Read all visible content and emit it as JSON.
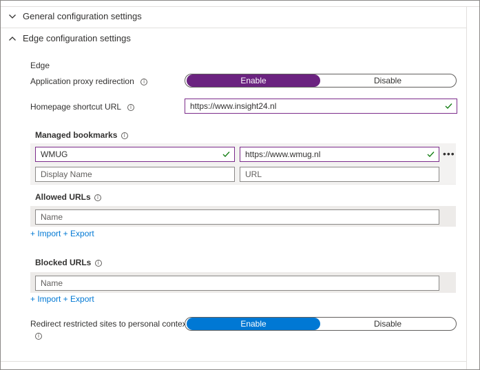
{
  "sections": {
    "general": {
      "title": "General configuration settings"
    },
    "edge": {
      "title": "Edge configuration settings"
    }
  },
  "edge": {
    "heading": "Edge",
    "proxy": {
      "label": "Application proxy redirection",
      "enable": "Enable",
      "disable": "Disable",
      "selected": "Enable",
      "accent": "#6b2380"
    },
    "homepage": {
      "label": "Homepage shortcut URL",
      "value": "https://www.insight24.nl"
    },
    "bookmarks": {
      "label": "Managed bookmarks",
      "rows": [
        {
          "name": "WMUG",
          "url": "https://www.wmug.nl"
        }
      ],
      "new_row": {
        "name_placeholder": "Display Name",
        "url_placeholder": "URL"
      }
    },
    "allowed": {
      "label": "Allowed URLs",
      "placeholder": "Name",
      "actions": "+ Import + Export"
    },
    "blocked": {
      "label": "Blocked URLs",
      "placeholder": "Name",
      "actions": "+ Import + Export"
    },
    "redirect": {
      "label": "Redirect restricted sites to personal context",
      "enable": "Enable",
      "disable": "Disable",
      "selected": "Enable",
      "accent": "#0078d4"
    }
  },
  "icons": {
    "chevron_collapsed": "chevron-down-icon",
    "chevron_expanded": "chevron-up-icon",
    "info": "info-icon",
    "check": "check-icon",
    "more": "more-icon"
  },
  "colors": {
    "valid_border": "#7a2a8a",
    "check": "#107c10",
    "link": "#0078d4"
  }
}
